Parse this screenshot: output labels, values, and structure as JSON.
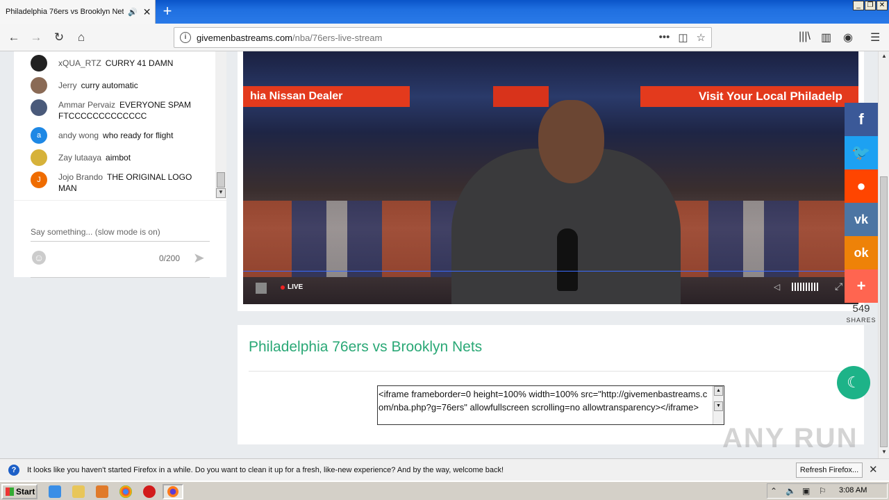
{
  "browser": {
    "tab_title": "Philadelphia 76ers vs Brooklyn Nets",
    "url_domain": "givemenbastreams.com",
    "url_path": "/nba/76ers-live-stream"
  },
  "chat": {
    "messages": [
      {
        "author": "xQUA_RTZ",
        "text": "CURRY 41 DAMN",
        "avatar_letter": "",
        "avatar_color": "#222222"
      },
      {
        "author": "Jerry",
        "text": "curry automatic",
        "avatar_letter": "",
        "avatar_color": "#8a6a55"
      },
      {
        "author": "Ammar Pervaiz",
        "text": "EVERYONE SPAM FTCCCCCCCCCCCCC",
        "avatar_letter": "",
        "avatar_color": "#4a5a7a"
      },
      {
        "author": "andy wong",
        "text": "who ready for flight",
        "avatar_letter": "a",
        "avatar_color": "#1e88e5"
      },
      {
        "author": "Zay lutaaya",
        "text": "aimbot",
        "avatar_letter": "",
        "avatar_color": "#d6b23a"
      },
      {
        "author": "Jojo Brando",
        "text": "THE ORIGINAL LOGO MAN",
        "avatar_letter": "J",
        "avatar_color": "#ef6c00"
      }
    ],
    "input_placeholder": "Say something... (slow mode is on)",
    "char_count": "0/200"
  },
  "video": {
    "live_label": "LIVE",
    "banner_left": "hia Nissan Dealer",
    "banner_right": "Visit Your Local Philadelp"
  },
  "page": {
    "title": "Philadelphia 76ers vs Brooklyn Nets",
    "embed_code": "<iframe frameborder=0 height=100% width=100% src=\"http://givemenbastreams.com/nba.php?g=76ers\" allowfullscreen scrolling=no allowtransparency></iframe>"
  },
  "share": {
    "buttons": [
      {
        "name": "facebook",
        "glyph": "f",
        "color": "#3b5998"
      },
      {
        "name": "twitter",
        "glyph": "t",
        "color": "#1da1f2"
      },
      {
        "name": "reddit",
        "glyph": "r",
        "color": "#ff4500"
      },
      {
        "name": "vk",
        "glyph": "vk",
        "color": "#4c75a3"
      },
      {
        "name": "odnoklassniki",
        "glyph": "ok",
        "color": "#ee8208"
      },
      {
        "name": "more",
        "glyph": "+",
        "color": "#ff6550"
      }
    ],
    "count": "549",
    "label": "SHARES"
  },
  "notification": {
    "text": "It looks like you haven't started Firefox in a while. Do you want to clean it up for a fresh, like-new experience? And by the way, welcome back!",
    "button": "Refresh Firefox..."
  },
  "taskbar": {
    "start": "Start",
    "clock": "3:08 AM"
  },
  "watermark": "ANY RUN"
}
